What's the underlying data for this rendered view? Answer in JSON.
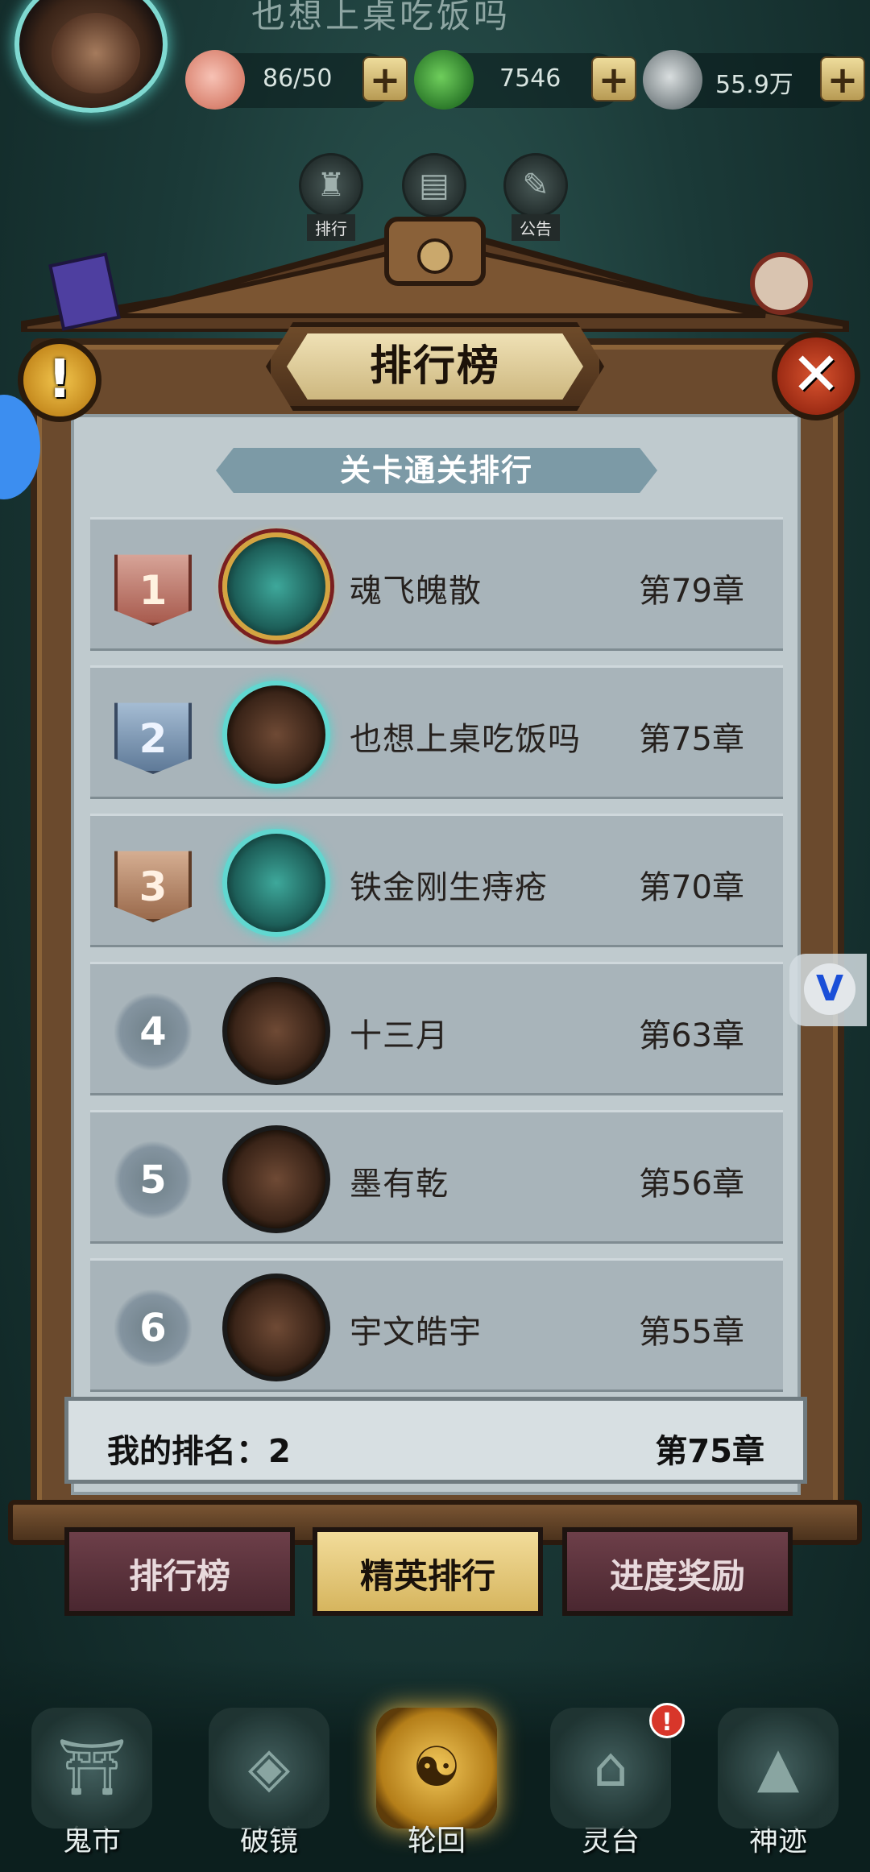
{
  "header": {
    "player_name": "也想上桌吃饭吗",
    "resources": [
      {
        "icon": "peach-icon",
        "value": "86/50"
      },
      {
        "icon": "jade-coin-icon",
        "value": "7546"
      },
      {
        "icon": "silver-coin-icon",
        "value": "55.9万"
      }
    ],
    "plus_label": "+"
  },
  "top_tabs": [
    {
      "icon": "ranking-icon",
      "label": "排行"
    },
    {
      "icon": "scroll-icon",
      "label": ""
    },
    {
      "icon": "notice-icon",
      "label": "公告"
    }
  ],
  "panel": {
    "title": "排行榜",
    "warn_symbol": "!",
    "close_symbol": "✕",
    "subtitle": "关卡通关排行",
    "rows": [
      {
        "rank": "1",
        "name": "魂飞魄散",
        "score": "第79章"
      },
      {
        "rank": "2",
        "name": "也想上桌吃饭吗",
        "score": "第75章"
      },
      {
        "rank": "3",
        "name": "铁金刚生痔疮",
        "score": "第70章"
      },
      {
        "rank": "4",
        "name": "十三月",
        "score": "第63章"
      },
      {
        "rank": "5",
        "name": "墨有乾",
        "score": "第56章"
      },
      {
        "rank": "6",
        "name": "宇文皓宇",
        "score": "第55章"
      }
    ],
    "my_rank_label": "我的排名：2",
    "my_rank_score": "第75章"
  },
  "tabs": [
    {
      "label": "排行榜",
      "active": false
    },
    {
      "label": "精英排行",
      "active": true
    },
    {
      "label": "进度奖励",
      "active": false
    }
  ],
  "bottom_nav": [
    {
      "icon": "market-icon",
      "label": "鬼市"
    },
    {
      "icon": "broken-mirror-icon",
      "label": "破镜"
    },
    {
      "icon": "yin-yang-icon",
      "label": "轮回"
    },
    {
      "icon": "shrine-icon",
      "label": "灵台"
    },
    {
      "icon": "relic-icon",
      "label": "神迹"
    }
  ],
  "badge": "!",
  "side_widget": "V",
  "colors": {
    "accent_gold": "#d6b55e",
    "tab_inactive": "#6d3f49",
    "frame_wood": "#6b4a2d"
  }
}
